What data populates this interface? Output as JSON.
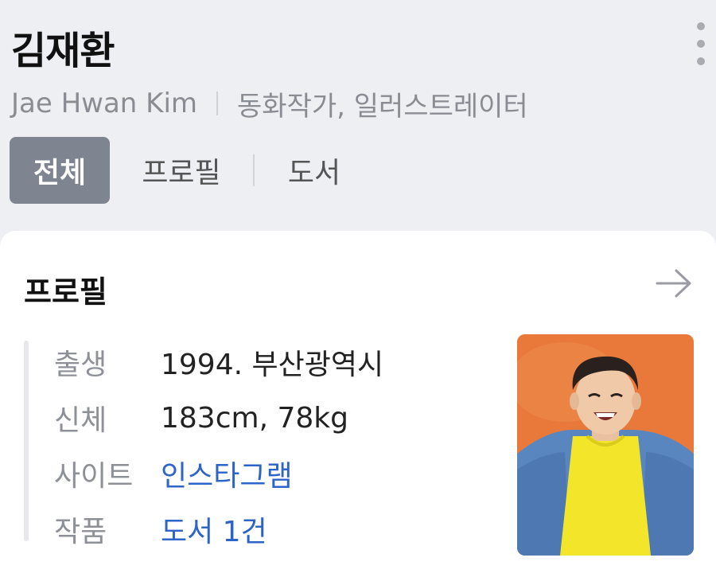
{
  "person": {
    "name": "김재환",
    "english_name": "Jae Hwan Kim",
    "occupation": "동화작가, 일러스트레이터"
  },
  "tabs": [
    {
      "label": "전체",
      "active": true
    },
    {
      "label": "프로필",
      "active": false
    },
    {
      "label": "도서",
      "active": false
    }
  ],
  "profile": {
    "title": "프로필",
    "rows": [
      {
        "label": "출생",
        "value": "1994. 부산광역시"
      },
      {
        "label": "신체",
        "value": "183cm, 78kg"
      },
      {
        "label": "사이트",
        "value": "인스타그램"
      },
      {
        "label": "작품",
        "value": "도서 1건"
      }
    ]
  },
  "icons": {
    "more": "more-vertical-icon",
    "arrow": "arrow-right-icon"
  },
  "colors": {
    "background": "#eeeff3",
    "active_tab": "#7e8590",
    "link": "#2d64c8",
    "photo_bg": "#e8793a"
  }
}
